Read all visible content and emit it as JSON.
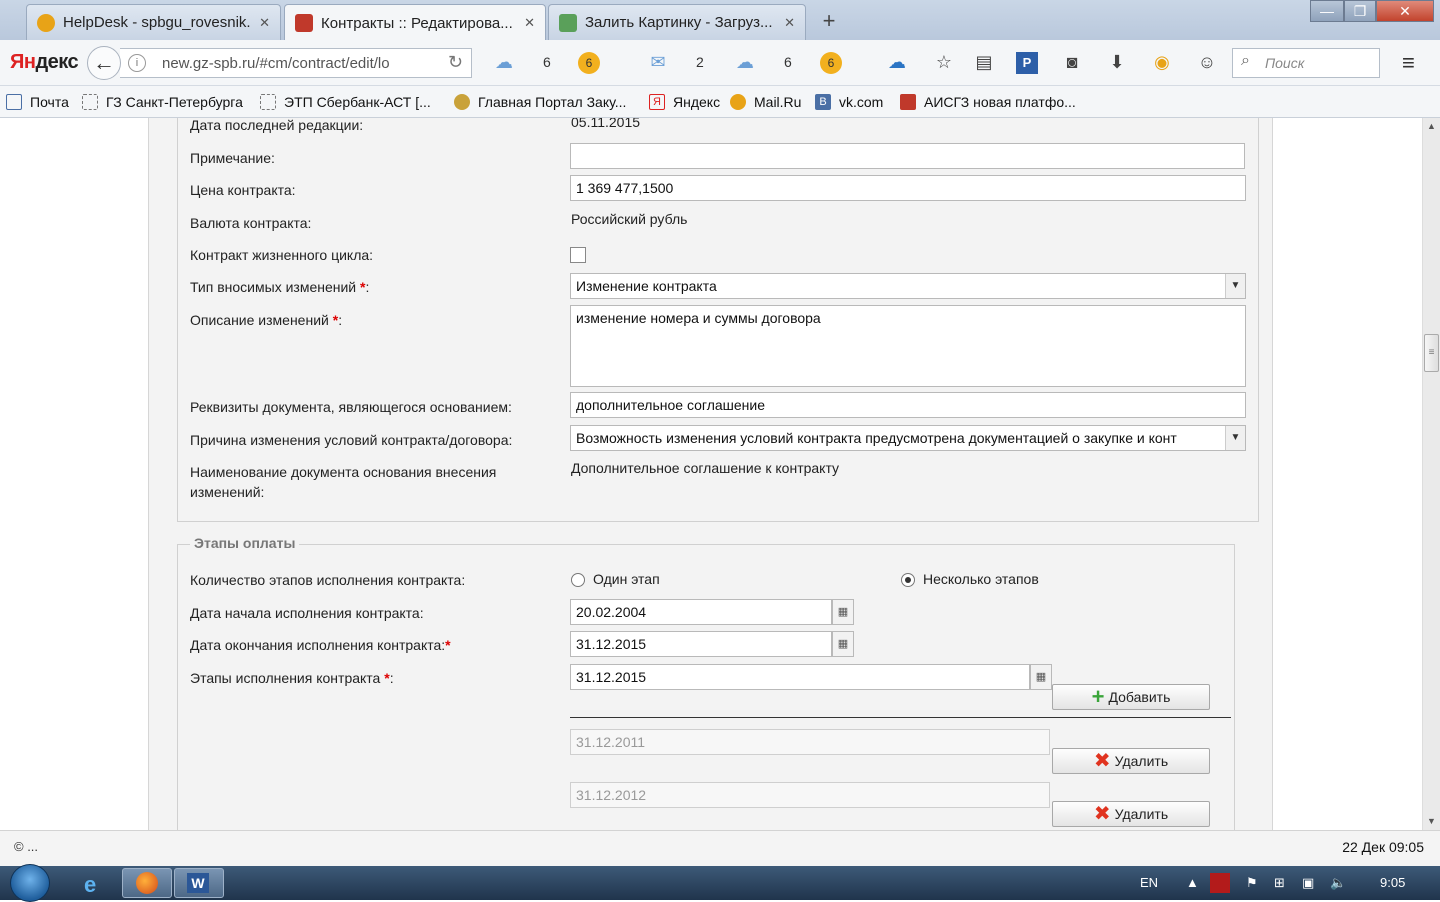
{
  "tabs": [
    {
      "label": "HelpDesk - spbgu_rovesnik...",
      "close": "✕",
      "icon_color": "#e8a317"
    },
    {
      "label": "Контракты :: Редактирова...",
      "close": "✕",
      "icon_color": "#c0392b"
    },
    {
      "label": "Залить Картинку - Загруз...",
      "close": "✕",
      "icon_color": "#5aa05a"
    }
  ],
  "new_tab": "+",
  "window": {
    "minimize": "—",
    "maximize": "❐",
    "close": "✕"
  },
  "nav": {
    "logo_red": "Ян",
    "logo_dark": "декс",
    "back": "←",
    "url": "new.gz-spb.ru/#cm/contract/edit/lo",
    "reload": "↻",
    "cloud_count_1": "6",
    "badge_1": "6",
    "mail_count": "2",
    "cloud_count_2": "6",
    "badge_2": "6",
    "search_placeholder": "Поиск",
    "menu": "≡"
  },
  "bookmarks": [
    "Почта",
    "ГЗ Санкт-Петербурга",
    "ЭТП Сбербанк-АСТ [...",
    "Главная Портал Заку...",
    "Яндекс",
    "Mail.Ru",
    "vk.com",
    "АИСГЗ новая платфо..."
  ],
  "form": {
    "last_edit_label": "Дата последней редакции:",
    "last_edit_value": "05.11.2015",
    "note_label": "Примечание:",
    "note_value": "",
    "price_label": "Цена контракта:",
    "price_value": "1 369 477,1500",
    "currency_label": "Валюта контракта:",
    "currency_value": "Российский рубль",
    "lifecycle_label": "Контракт жизненного цикла:",
    "change_type_label": "Тип вносимых изменений",
    "change_type_value": "Изменение контракта",
    "change_desc_label": "Описание изменений",
    "change_desc_value": "изменение номера и суммы договора",
    "basis_doc_label": "Реквизиты документа, являющегося основанием:",
    "basis_doc_value": "дополнительное соглашение",
    "reason_label": "Причина изменения условий контракта/договора:",
    "reason_value": "Возможность изменения условий контракта предусмотрена документацией о закупке и конт",
    "doc_name_label_1": "Наименование документа основания внесения",
    "doc_name_label_2": "изменений:",
    "doc_name_value": "Дополнительное соглашение к контракту",
    "required_mark": "*",
    "colon": ":"
  },
  "payment": {
    "legend": "Этапы оплаты",
    "stages_count_label": "Количество этапов исполнения контракта:",
    "option_one": "Один этап",
    "option_many": "Несколько этапов",
    "selected": "many",
    "start_label": "Дата начала исполнения контракта:",
    "start_value": "20.02.2004",
    "end_label": "Дата окончания исполнения контракта:",
    "end_value": "31.12.2015",
    "stages_label": "Этапы исполнения контракта",
    "stages_value": "31.12.2015",
    "add_button": "Добавить",
    "stage_list": [
      "31.12.2011",
      "31.12.2012"
    ],
    "delete_button": "Удалить"
  },
  "status": {
    "left": "© ...",
    "right": "22 Дек 09:05"
  },
  "taskbar": {
    "lang": "EN",
    "time": "9:05"
  }
}
